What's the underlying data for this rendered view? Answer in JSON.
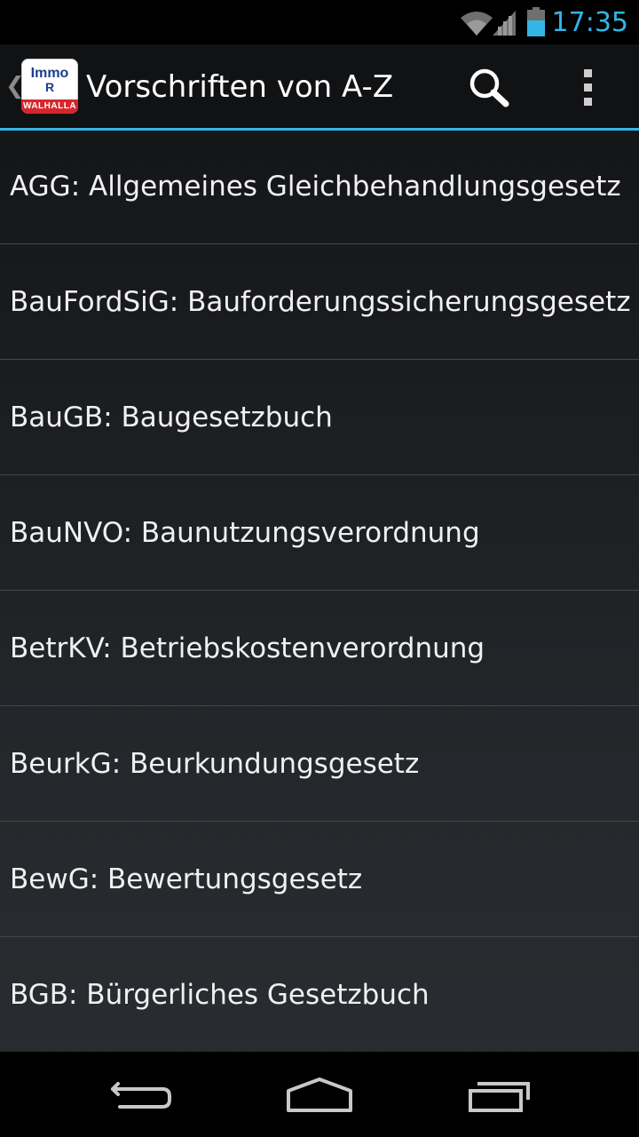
{
  "status_bar": {
    "time": "17:35",
    "icons": [
      "wifi-icon",
      "cell-signal-icon",
      "battery-icon"
    ],
    "accent_color": "#33b5e5"
  },
  "action_bar": {
    "up_icon": "chevron-left-icon",
    "app_logo": {
      "line1": "Immo",
      "line2": "R",
      "band": "WALHALLA"
    },
    "title": "Vorschriften von A-Z",
    "actions": [
      "search-icon",
      "overflow-menu-icon"
    ]
  },
  "list": {
    "items": [
      {
        "label": "AGG: Allgemeines Gleichbehandlungsgesetz"
      },
      {
        "label": "BauFordSiG: Bauforderungssicherungsgesetz"
      },
      {
        "label": "BauGB: Baugesetzbuch"
      },
      {
        "label": "BauNVO: Baunutzungsverordnung"
      },
      {
        "label": "BetrKV: Betriebskostenverordnung"
      },
      {
        "label": "BeurkG: Beurkundungsgesetz"
      },
      {
        "label": "BewG: Bewertungsgesetz"
      },
      {
        "label": "BGB: Bürgerliches Gesetzbuch"
      }
    ]
  },
  "nav_bar": {
    "buttons": [
      "back-icon",
      "home-icon",
      "recent-apps-icon"
    ]
  }
}
